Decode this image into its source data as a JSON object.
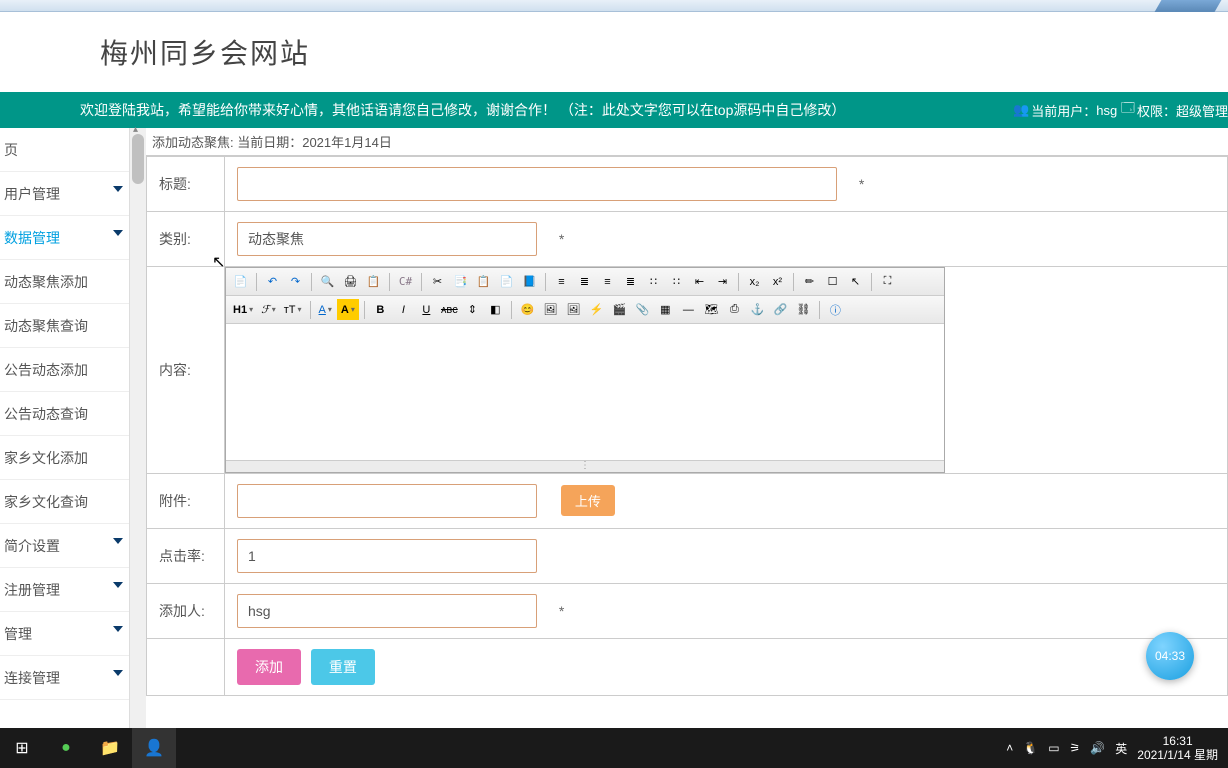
{
  "header": {
    "title": "梅州同乡会网站"
  },
  "teal": {
    "welcome": "欢迎登陆我站，希望能给你带来好心情，其他话语请您自己修改，谢谢合作！ （注：此处文字您可以在top源码中自己修改）",
    "user_label": "当前用户：",
    "user": "hsg",
    "role_label": "权限：",
    "role": "超级管理"
  },
  "sidebar": {
    "items": [
      {
        "label": "页",
        "chev": false
      },
      {
        "label": "用户管理",
        "chev": true
      },
      {
        "label": "数据管理",
        "chev": true,
        "active": true
      },
      {
        "label": "动态聚焦添加",
        "chev": false
      },
      {
        "label": "动态聚焦查询",
        "chev": false
      },
      {
        "label": "公告动态添加",
        "chev": false
      },
      {
        "label": "公告动态查询",
        "chev": false
      },
      {
        "label": "家乡文化添加",
        "chev": false
      },
      {
        "label": "家乡文化查询",
        "chev": false
      },
      {
        "label": "简介设置",
        "chev": true
      },
      {
        "label": "注册管理",
        "chev": true
      },
      {
        "label": "管理",
        "chev": true
      },
      {
        "label": "连接管理",
        "chev": true
      }
    ]
  },
  "crumb": {
    "text": "添加动态聚焦:   当前日期：2021年1月14日"
  },
  "form": {
    "title_label": "标题:",
    "title_value": "",
    "title_star": "*",
    "category_label": "类别:",
    "category_value": "动态聚焦",
    "category_star": "*",
    "content_label": "内容:",
    "attach_label": "附件:",
    "attach_value": "",
    "upload_btn": "上传",
    "clicks_label": "点击率:",
    "clicks_value": "1",
    "adder_label": "添加人:",
    "adder_value": "hsg",
    "adder_star": "*",
    "submit_btn": "添加",
    "reset_btn": "重置"
  },
  "timer": {
    "value": "04:33"
  },
  "taskbar": {
    "ime": "英",
    "time": "16:31",
    "date": "2021/1/14 星期"
  }
}
